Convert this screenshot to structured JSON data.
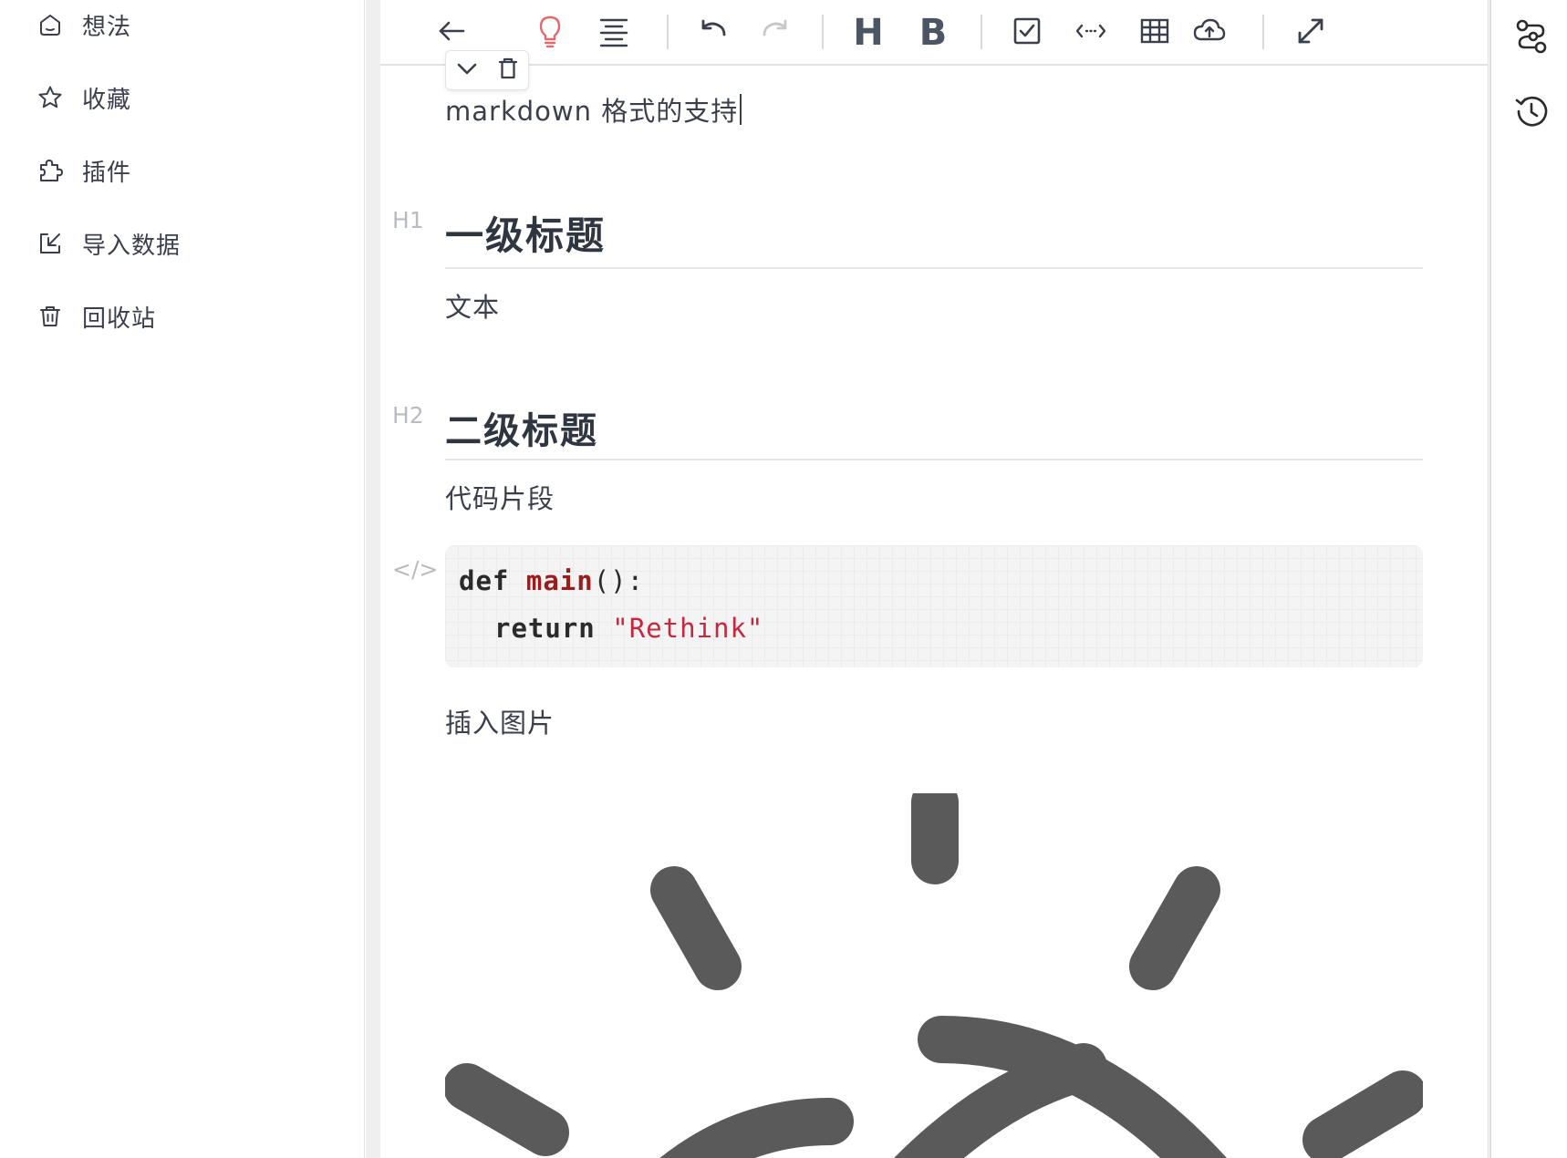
{
  "sidebar": {
    "items": [
      {
        "label": "想法",
        "icon": "home-icon"
      },
      {
        "label": "收藏",
        "icon": "star-icon"
      },
      {
        "label": "插件",
        "icon": "puzzle-icon"
      },
      {
        "label": "导入数据",
        "icon": "import-icon"
      },
      {
        "label": "回收站",
        "icon": "trash-icon"
      }
    ]
  },
  "toolbar": {
    "buttons": [
      {
        "icon": "arrow-left-icon"
      },
      {
        "icon": "lightbulb-icon",
        "color": "#e36a6a"
      },
      {
        "icon": "align-center-icon"
      },
      {
        "icon": "undo-icon"
      },
      {
        "icon": "redo-icon",
        "disabled": true
      },
      {
        "icon": "heading-icon",
        "text": "H"
      },
      {
        "icon": "bold-icon",
        "text": "B"
      },
      {
        "icon": "checkbox-icon"
      },
      {
        "icon": "code-icon"
      },
      {
        "icon": "table-icon"
      },
      {
        "icon": "cloud-upload-icon"
      },
      {
        "icon": "expand-icon"
      }
    ]
  },
  "block_menu": {
    "items": [
      {
        "icon": "chevron-down-icon"
      },
      {
        "icon": "delete-icon"
      }
    ]
  },
  "document": {
    "intro": "markdown 格式的支持",
    "h1": {
      "tag": "H1",
      "text": "一级标题"
    },
    "p1": "文本",
    "h2": {
      "tag": "H2",
      "text": "二级标题"
    },
    "p2": "代码片段",
    "code": {
      "tag": "</>",
      "line1": {
        "keyword": "def",
        "name": "main",
        "punct": "():"
      },
      "line2": {
        "keyword": "return",
        "string": "\"Rethink\""
      }
    },
    "p3": "插入图片",
    "image": {
      "icon": "sun-icon",
      "color": "#5a5a5a"
    }
  },
  "right_panel": {
    "buttons": [
      {
        "icon": "graph-icon"
      },
      {
        "icon": "history-icon"
      }
    ]
  },
  "colors": {
    "text": "#3a404b",
    "accent": "#e36a6a",
    "code_fn": "#9b1c1c",
    "code_string": "#c8283f"
  }
}
